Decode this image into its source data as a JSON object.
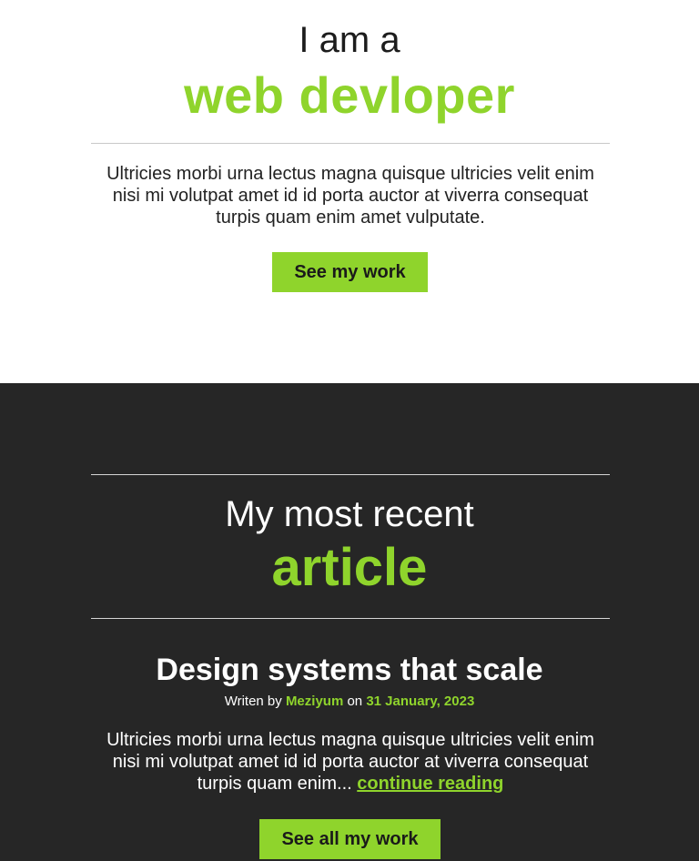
{
  "hero": {
    "pre_title": "I am a",
    "title": "web devloper",
    "text": "Ultricies morbi urna lectus magna quisque ultricies velit enim nisi mi volutpat amet id id porta auctor at viverra consequat turpis quam enim amet vulputate.",
    "button_label": "See my work"
  },
  "articles": {
    "pre_title": "My most recent",
    "title": "article",
    "post": {
      "title": "Design systems that scale",
      "written_by_label": "Writen by",
      "author": "Meziyum",
      "on_label": "on",
      "date": "31 January, 2023",
      "excerpt": "Ultricies morbi urna lectus magna quisque ultricies velit enim nisi mi volutpat amet id id porta auctor at viverra consequat turpis quam enim...",
      "continue_label": "continue reading"
    },
    "button_label": "See all my work"
  },
  "colors": {
    "accent": "#8fd42c",
    "dark_bg": "#262626",
    "light_bg": "#ffffff"
  }
}
